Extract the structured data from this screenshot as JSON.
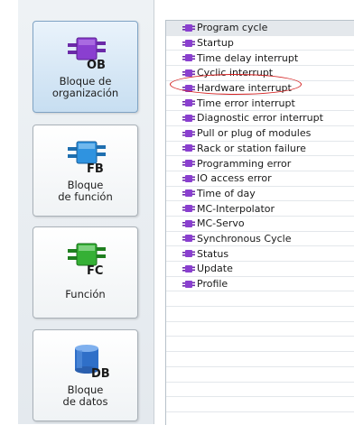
{
  "blocks": [
    {
      "id": "ob",
      "code": "OB",
      "label": "Bloque de\norganización",
      "selected": true,
      "color": "#7f3fbf"
    },
    {
      "id": "fb",
      "code": "FB",
      "label": "Bloque\nde función",
      "selected": false,
      "color": "#2a8bd8"
    },
    {
      "id": "fc",
      "code": "FC",
      "label": "Función",
      "selected": false,
      "color": "#2aa02a"
    },
    {
      "id": "db",
      "code": "DB",
      "label": "Bloque\nde datos",
      "selected": false,
      "color": "#2f6fc8"
    }
  ],
  "ob_list": [
    "Program cycle",
    "Startup",
    "Time delay interrupt",
    "Cyclic interrupt",
    "Hardware interrupt",
    "Time error interrupt",
    "Diagnostic error interrupt",
    "Pull or plug of modules",
    "Rack or station failure",
    "Programming error",
    "IO access error",
    "Time of day",
    "MC-Interpolator",
    "MC-Servo",
    "Synchronous Cycle",
    "Status",
    "Update",
    "Profile"
  ],
  "highlighted_item": "Cyclic interrupt",
  "colors": {
    "ob_icon": "#7a2fb8",
    "highlight": "#d42020"
  }
}
